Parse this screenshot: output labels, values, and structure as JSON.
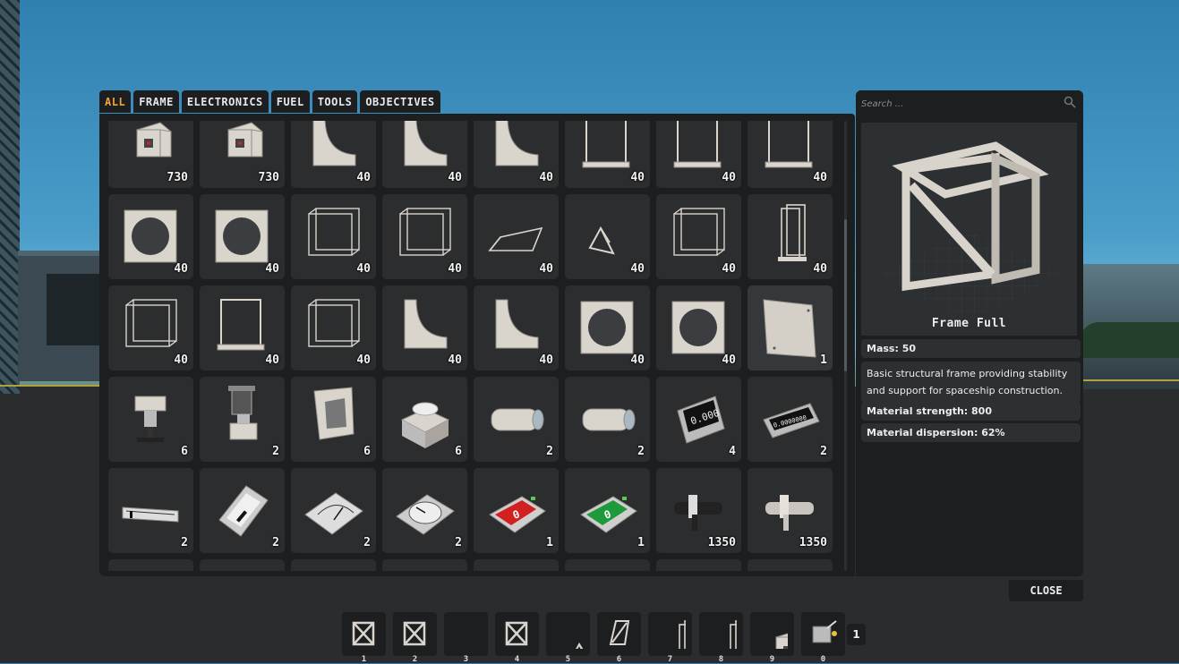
{
  "tabs": [
    {
      "label": "ALL",
      "active": true
    },
    {
      "label": "FRAME",
      "active": false
    },
    {
      "label": "ELECTRONICS",
      "active": false
    },
    {
      "label": "FUEL",
      "active": false
    },
    {
      "label": "TOOLS",
      "active": false
    },
    {
      "label": "OBJECTIVES",
      "active": false
    }
  ],
  "search": {
    "placeholder": "Search ..."
  },
  "inventory": [
    {
      "icon": "small-crate-icon",
      "qty": "730"
    },
    {
      "icon": "small-crate-icon",
      "qty": "730"
    },
    {
      "icon": "frame-curved-icon",
      "qty": "40"
    },
    {
      "icon": "frame-curved-icon",
      "qty": "40"
    },
    {
      "icon": "frame-curved-icon",
      "qty": "40"
    },
    {
      "icon": "frame-panel-icon",
      "qty": "40"
    },
    {
      "icon": "frame-panel-icon",
      "qty": "40"
    },
    {
      "icon": "frame-panel-icon",
      "qty": "40"
    },
    {
      "icon": "frame-round-hole-icon",
      "qty": "40"
    },
    {
      "icon": "frame-round-hole-icon",
      "qty": "40"
    },
    {
      "icon": "frame-open-icon",
      "qty": "40"
    },
    {
      "icon": "frame-open-icon",
      "qty": "40"
    },
    {
      "icon": "frame-wedge-icon",
      "qty": "40"
    },
    {
      "icon": "frame-tetra-icon",
      "qty": "40"
    },
    {
      "icon": "frame-open-icon",
      "qty": "40"
    },
    {
      "icon": "frame-slim-icon",
      "qty": "40"
    },
    {
      "icon": "frame-open-icon",
      "qty": "40"
    },
    {
      "icon": "frame-panel-icon",
      "qty": "40"
    },
    {
      "icon": "frame-open-icon",
      "qty": "40"
    },
    {
      "icon": "frame-curved-icon",
      "qty": "40"
    },
    {
      "icon": "frame-curved-icon",
      "qty": "40"
    },
    {
      "icon": "frame-round-hole-icon",
      "qty": "40"
    },
    {
      "icon": "frame-round-hole-icon",
      "qty": "40"
    },
    {
      "icon": "hull-plate-icon",
      "qty": "1"
    },
    {
      "icon": "thruster-mount-icon",
      "qty": "6"
    },
    {
      "icon": "engine-nozzle-icon",
      "qty": "2"
    },
    {
      "icon": "panel-bracket-icon",
      "qty": "6"
    },
    {
      "icon": "cooler-unit-icon",
      "qty": "6"
    },
    {
      "icon": "fuel-tank-icon",
      "qty": "2"
    },
    {
      "icon": "fuel-tank-icon",
      "qty": "2"
    },
    {
      "icon": "digital-display-icon",
      "qty": "4"
    },
    {
      "icon": "digital-display-wide-icon",
      "qty": "2"
    },
    {
      "icon": "linear-gauge-icon",
      "qty": "2"
    },
    {
      "icon": "bar-meter-icon",
      "qty": "2"
    },
    {
      "icon": "analog-meter-icon",
      "qty": "2"
    },
    {
      "icon": "dial-gauge-icon",
      "qty": "2"
    },
    {
      "icon": "red-button-icon",
      "qty": "1"
    },
    {
      "icon": "green-button-icon",
      "qty": "1"
    },
    {
      "icon": "pipe-connector-dark-icon",
      "qty": "1350"
    },
    {
      "icon": "pipe-connector-light-icon",
      "qty": "1350"
    },
    {
      "icon": "",
      "qty": ""
    },
    {
      "icon": "",
      "qty": ""
    },
    {
      "icon": "",
      "qty": ""
    },
    {
      "icon": "",
      "qty": ""
    },
    {
      "icon": "",
      "qty": ""
    },
    {
      "icon": "",
      "qty": ""
    },
    {
      "icon": "",
      "qty": ""
    },
    {
      "icon": "",
      "qty": ""
    }
  ],
  "details": {
    "name": "Frame Full",
    "mass": "Mass: 50",
    "description": "Basic structural frame providing stability and support for spaceship construction.",
    "strength": "Material strength: 800",
    "dispersion": "Material dispersion: 62%"
  },
  "close_label": "CLOSE",
  "hotbar": [
    {
      "key": "1",
      "icon": "frame-full-icon"
    },
    {
      "key": "2",
      "icon": "frame-full-icon"
    },
    {
      "key": "3",
      "icon": "frame-wedge-icon"
    },
    {
      "key": "4",
      "icon": "frame-full-icon"
    },
    {
      "key": "5",
      "icon": "frame-tetra-icon"
    },
    {
      "key": "6",
      "icon": "frame-half-icon"
    },
    {
      "key": "7",
      "icon": "frame-slim-icon"
    },
    {
      "key": "8",
      "icon": "frame-slim-icon"
    },
    {
      "key": "9",
      "icon": "small-crate-icon"
    },
    {
      "key": "0",
      "icon": "welding-tool-icon"
    }
  ],
  "hotbar_count": "1",
  "colors": {
    "accent": "#f0a23c",
    "panel": "#1c1e20",
    "cell": "#2b2d2f"
  }
}
